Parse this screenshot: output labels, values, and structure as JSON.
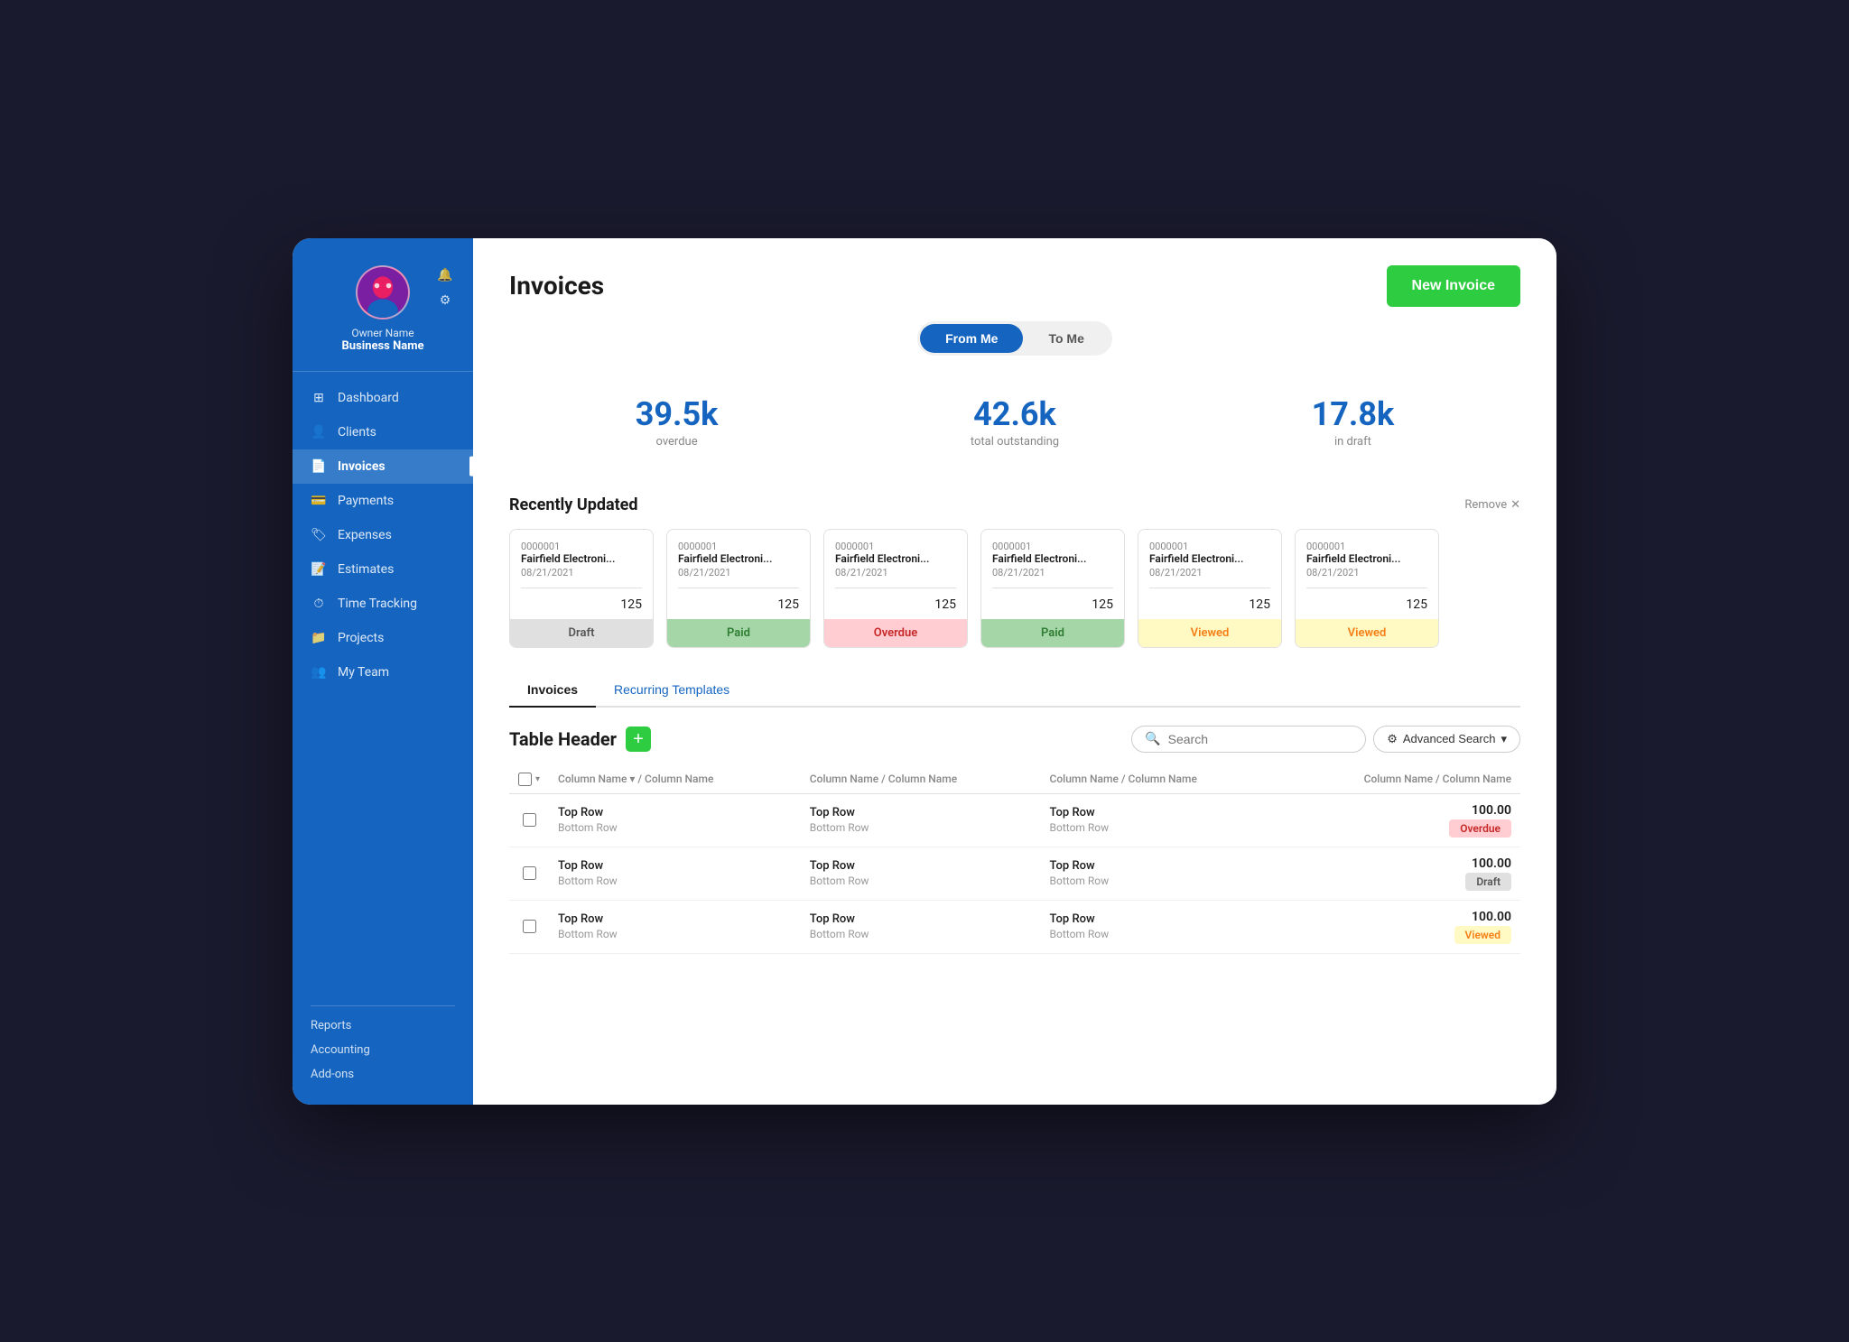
{
  "sidebar": {
    "owner_name": "Owner Name",
    "business_name": "Business Name",
    "nav_items": [
      {
        "id": "dashboard",
        "label": "Dashboard",
        "icon": "⊞"
      },
      {
        "id": "clients",
        "label": "Clients",
        "icon": "👤"
      },
      {
        "id": "invoices",
        "label": "Invoices",
        "icon": "📄",
        "active": true
      },
      {
        "id": "payments",
        "label": "Payments",
        "icon": "💳"
      },
      {
        "id": "expenses",
        "label": "Expenses",
        "icon": "🏷"
      },
      {
        "id": "estimates",
        "label": "Estimates",
        "icon": "📝"
      },
      {
        "id": "time-tracking",
        "label": "Time Tracking",
        "icon": "⏱"
      },
      {
        "id": "projects",
        "label": "Projects",
        "icon": "📁"
      },
      {
        "id": "my-team",
        "label": "My Team",
        "icon": "👥"
      }
    ],
    "secondary_items": [
      {
        "id": "reports",
        "label": "Reports"
      },
      {
        "id": "accounting",
        "label": "Accounting"
      },
      {
        "id": "add-ons",
        "label": "Add-ons"
      }
    ]
  },
  "page": {
    "title": "Invoices",
    "new_invoice_label": "New Invoice"
  },
  "toggle": {
    "from_me": "From Me",
    "to_me": "To Me"
  },
  "stats": [
    {
      "id": "overdue",
      "value": "39.5k",
      "label": "overdue"
    },
    {
      "id": "total_outstanding",
      "value": "42.6k",
      "label": "total outstanding"
    },
    {
      "id": "in_draft",
      "value": "17.8k",
      "label": "in draft"
    }
  ],
  "recently_updated": {
    "title": "Recently Updated",
    "remove_label": "Remove",
    "cards": [
      {
        "number": "0000001",
        "client": "Fairfield Electroni...",
        "date": "08/21/2021",
        "amount": "125",
        "status": "Draft",
        "status_class": "status-draft"
      },
      {
        "number": "0000001",
        "client": "Fairfield Electroni...",
        "date": "08/21/2021",
        "amount": "125",
        "status": "Paid",
        "status_class": "status-paid"
      },
      {
        "number": "0000001",
        "client": "Fairfield Electroni...",
        "date": "08/21/2021",
        "amount": "125",
        "status": "Overdue",
        "status_class": "status-overdue"
      },
      {
        "number": "0000001",
        "client": "Fairfield Electroni...",
        "date": "08/21/2021",
        "amount": "125",
        "status": "Paid",
        "status_class": "status-paid"
      },
      {
        "number": "0000001",
        "client": "Fairfield Electroni...",
        "date": "08/21/2021",
        "amount": "125",
        "status": "Viewed",
        "status_class": "status-viewed"
      },
      {
        "number": "0000001",
        "client": "Fairfield Electroni...",
        "date": "08/21/2021",
        "amount": "125",
        "status": "Viewed",
        "status_class": "status-viewed"
      }
    ]
  },
  "tabs": [
    {
      "id": "invoices",
      "label": "Invoices",
      "active": true
    },
    {
      "id": "recurring-templates",
      "label": "Recurring Templates",
      "active": false
    }
  ],
  "table": {
    "header_title": "Table Header",
    "add_btn_label": "+",
    "search_placeholder": "Search",
    "advanced_search_label": "Advanced Search",
    "columns": [
      {
        "label": "Column Name ▾ / Column Name",
        "sortable": true
      },
      {
        "label": "Column Name / Column Name"
      },
      {
        "label": "Column Name / Column Name"
      },
      {
        "label": "Column Name / Column Name"
      }
    ],
    "rows": [
      {
        "top1": "Top Row",
        "bottom1": "Bottom Row",
        "top2": "Top Row",
        "bottom2": "Bottom Row",
        "top3": "Top Row",
        "bottom3": "Bottom Row",
        "amount": "100.00",
        "badge": "Overdue",
        "badge_class": "badge-overdue"
      },
      {
        "top1": "Top Row",
        "bottom1": "Bottom Row",
        "top2": "Top Row",
        "bottom2": "Bottom Row",
        "top3": "Top Row",
        "bottom3": "Bottom Row",
        "amount": "100.00",
        "badge": "Draft",
        "badge_class": "badge-draft"
      },
      {
        "top1": "Top Row",
        "bottom1": "Bottom Row",
        "top2": "Top Row",
        "bottom2": "Bottom Row",
        "top3": "Top Row",
        "bottom3": "Bottom Row",
        "amount": "100.00",
        "badge": "Viewed",
        "badge_class": "badge-viewed"
      }
    ]
  }
}
